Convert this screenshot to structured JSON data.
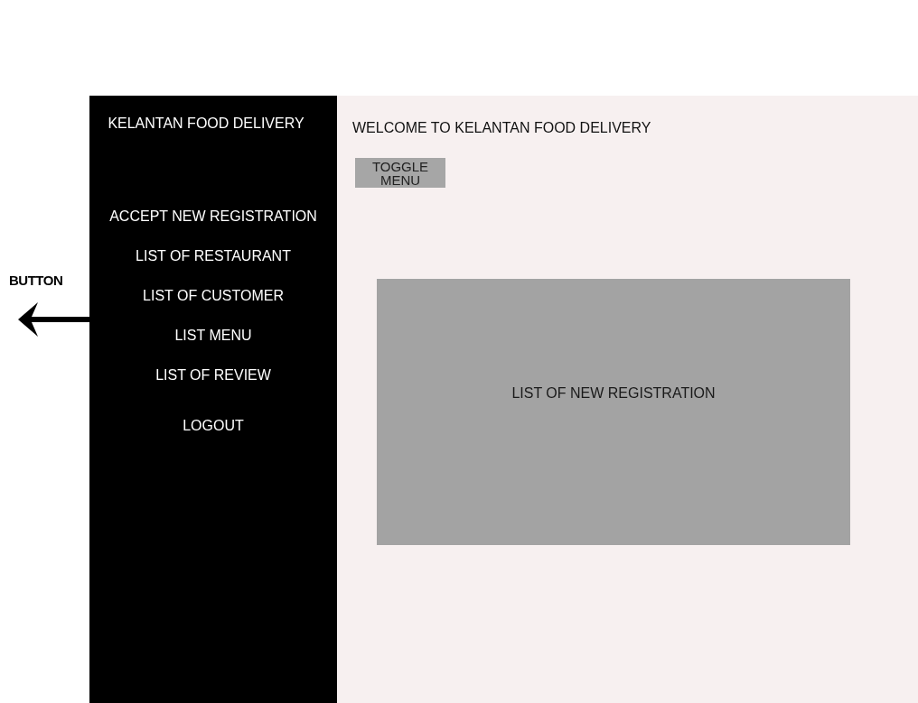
{
  "annotation": {
    "label": "BUTTON"
  },
  "sidebar": {
    "title": "KELANTAN FOOD DELIVERY",
    "items": [
      {
        "label": "ACCEPT NEW REGISTRATION"
      },
      {
        "label": "LIST OF RESTAURANT"
      },
      {
        "label": "LIST OF CUSTOMER"
      },
      {
        "label": "LIST MENU"
      },
      {
        "label": "LIST OF REVIEW"
      },
      {
        "label": "LOGOUT"
      }
    ]
  },
  "content": {
    "welcome": "WELCOME TO KELANTAN FOOD DELIVERY",
    "toggle_button": "TOGGLE MENU",
    "panel": "LIST OF NEW REGISTRATION"
  }
}
